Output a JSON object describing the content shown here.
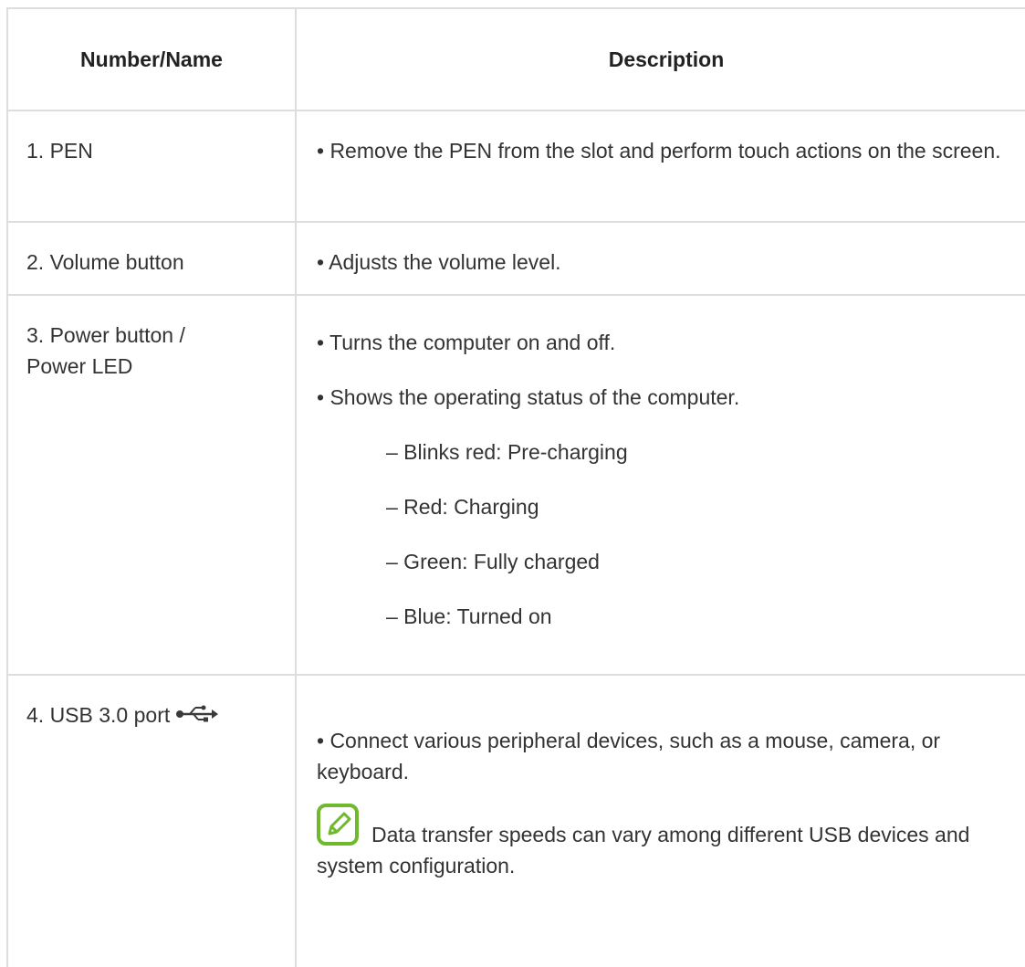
{
  "table": {
    "header": {
      "col1": "Number/Name",
      "col2": "Description"
    },
    "rows": [
      {
        "name": "1. PEN",
        "description": "• Remove the PEN from the slot and perform touch actions on the screen."
      },
      {
        "name": "2. Volume button",
        "description": "• Adjusts the volume level."
      },
      {
        "name_line1": "3. Power button /",
        "name_line2": "Power LED",
        "bullets": [
          "• Turns the computer on and off.",
          "• Shows the operating status of the computer."
        ],
        "sub_items": [
          "– Blinks red: Pre-charging",
          "– Red: Charging",
          "– Green: Fully charged",
          "– Blue: Turned on"
        ]
      },
      {
        "name": "4. USB 3.0 port",
        "name_icon": "usb-icon",
        "description": "• Connect various peripheral devices, such as a mouse, camera, or keyboard.",
        "note_icon": "note-pencil-icon",
        "note": "Data transfer speeds can vary among different USB devices and system configuration."
      }
    ]
  },
  "colors": {
    "border": "#dddddd",
    "text": "#333333",
    "note_icon_green": "#6fba2c"
  }
}
